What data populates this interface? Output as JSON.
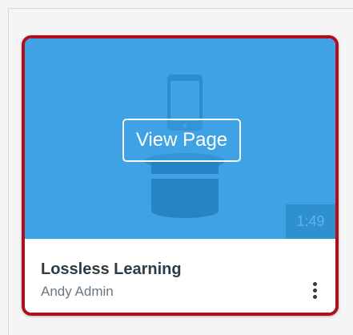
{
  "card": {
    "title": "Lossless Learning",
    "author": "Andy Admin",
    "view_button_label": "View Page",
    "duration": "1:49",
    "options_icon": "more-vertical-icon",
    "thumbnail_icon": "phone-on-podium-icon"
  },
  "colors": {
    "thumbnail_bg": "#3ea2e4",
    "highlight_border": "#b0101a",
    "title_text": "#2d3b45",
    "author_text": "#6b7780"
  }
}
